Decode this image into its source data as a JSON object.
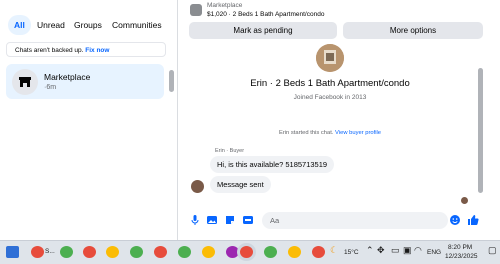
{
  "filters": {
    "all": "All",
    "unread": "Unread",
    "groups": "Groups",
    "communities": "Communities"
  },
  "backup": {
    "text": "Chats aren't backed up.",
    "link": "Fix now"
  },
  "conversation": {
    "name": "Marketplace",
    "time": "·6m"
  },
  "header": {
    "label": "Marketplace",
    "listing": "$1,020 · 2 Beds 1 Bath Apartment/condo"
  },
  "actions": {
    "pending": "Mark as pending",
    "more": "More options"
  },
  "chat": {
    "title": "Erin · 2 Beds 1 Bath Apartment/condo",
    "joined": "Joined Facebook in 2013",
    "started": "Erin started this chat.",
    "view_profile": "View buyer profile",
    "sender": "Erin · Buyer",
    "messages": [
      "Hi, is this available? 5185713519",
      "Message sent"
    ]
  },
  "composer": {
    "placeholder": "Aa"
  },
  "taskbar": {
    "weather": "15°C",
    "lang": "ENG",
    "time": "8:20 PM",
    "date": "12/23/2025",
    "first_label": "S..."
  },
  "colors": {
    "accent": "#0866ff",
    "bubble": "#f0f2f5",
    "active_bg": "#e7f3ff"
  }
}
